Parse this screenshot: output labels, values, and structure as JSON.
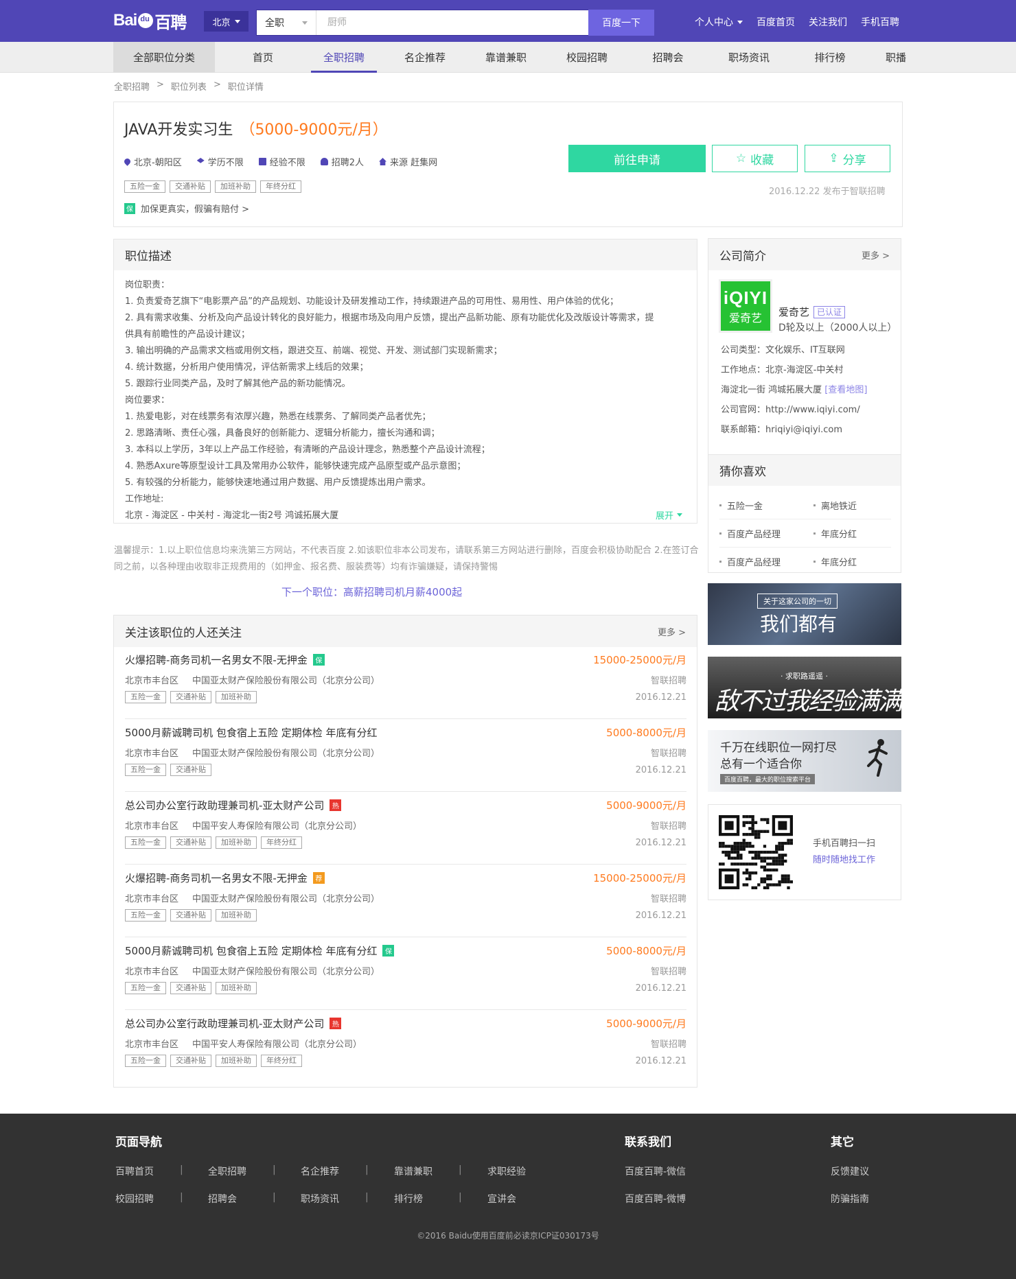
{
  "header": {
    "city": "北京",
    "search": {
      "scope": "全职",
      "placeholder": "厨师",
      "button": "百度一下"
    },
    "links": [
      "个人中心",
      "百度首页",
      "关注我们",
      "手机百聘"
    ]
  },
  "nav": {
    "all": "全部职位分类",
    "items": [
      "首页",
      "全职招聘",
      "名企推荐",
      "靠谱兼职",
      "校园招聘",
      "招聘会",
      "职场资讯",
      "排行榜",
      "职播"
    ],
    "active_index": 1
  },
  "breadcrumb": [
    "全职招聘",
    ">",
    "职位列表",
    ">",
    "职位详情"
  ],
  "job": {
    "title": "JAVA开发实习生",
    "salary": "（5000-9000元/月）",
    "meta": [
      "北京-朝阳区",
      "学历不限",
      "经验不限",
      "招聘2人",
      "来源 赶集网"
    ],
    "meta_icons": [
      "location-icon",
      "graduation-cap-icon",
      "document-icon",
      "person-icon",
      "home-icon"
    ],
    "tags": [
      "五险一金",
      "交通补贴",
      "加班补助",
      "年终分红"
    ],
    "guarantee_badge": "保",
    "guarantee": "加保更真实，假骗有赔付 >",
    "apply": "前往申请",
    "favorite": "收藏",
    "share": "分享",
    "published": "2016.12.22 发布于智联招聘"
  },
  "description": {
    "title": "职位描述",
    "lines": [
      "岗位职责：",
      "1. 负责爱奇艺旗下“电影票产品”的产品规划、功能设计及研发推动工作，持续跟进产品的可用性、易用性、用户体验的优化；",
      "2. 具有需求收集、分析及向产品设计转化的良好能力，根据市场及向用户反馈，提出产品新功能、原有功能优化及改版设计等需求，提",
      "供具有前瞻性的产品设计建议；",
      "3. 输出明确的产品需求文档或用例文档，跟进交互、前端、视觉、开发、测试部门实现新需求；",
      "4. 统计数据，分析用户使用情况，评估新需求上线后的效果；",
      "5. 跟踪行业同类产品，及时了解其他产品的新功能情况。",
      "岗位要求：",
      "1. 热爱电影，对在线票务有浓厚兴趣，熟悉在线票务、了解同类产品者优先；",
      "2. 思路清晰、责任心强，具备良好的创新能力、逻辑分析能力，擅长沟通和调；",
      "3. 本科以上学历，3年以上产品工作经验，有清晰的产品设计理念，熟悉整个产品设计流程；",
      "4. 熟悉Axure等原型设计工具及常用办公软件，能够快速完成产品原型或产品示意图；",
      "5. 有较强的分析能力，能够快速地通过用户数据、用户反馈提炼出用户需求。",
      "工作地址:",
      "北京 - 海淀区 - 中关村 - 海淀北一街2号 鸿诚拓展大厦"
    ],
    "expand": "展开"
  },
  "tips": "温馨提示：1.以上职位信息均来洗第三方网站，不代表百度 2.如该职位非本公司发布，请联系第三方网站进行删除，百度会积极协助配合 2.在签订合同之前，以各种理由收取非正规费用的（如押金、报名费、服装费等）均有诈骗嫌疑，请保持警惕",
  "next_job": "下一个职位：高薪招聘司机月薪4000起",
  "others": {
    "title": "关注该职位的人还关注",
    "more": "更多 >",
    "rows": [
      {
        "title": "火爆招聘-商务司机一名男女不限-无押金",
        "badge": "保",
        "badge_color": "#24c98d",
        "salary": "15000-25000元/月",
        "area": "北京市丰台区",
        "company": "中国亚太财产保险股份有限公司（北京分公司）",
        "source": "智联招聘",
        "date": "2016.12.21",
        "tags": [
          "五险一金",
          "交通补贴",
          "加班补助"
        ]
      },
      {
        "title": "5000月薪诚聘司机 包食宿上五险 定期体检 年底有分红",
        "badge": "",
        "badge_color": "",
        "salary": "5000-8000元/月",
        "area": "北京市丰台区",
        "company": "中国亚太财产保险股份有限公司（北京分公司）",
        "source": "智联招聘",
        "date": "2016.12.21",
        "tags": [
          "五险一金",
          "交通补贴"
        ]
      },
      {
        "title": "总公司办公室行政助理兼司机-亚太财产公司",
        "badge": "热",
        "badge_color": "#e8352e",
        "salary": "5000-9000元/月",
        "area": "北京市丰台区",
        "company": "中国平安人寿保险有限公司（北京分公司）",
        "source": "智联招聘",
        "date": "2016.12.21",
        "tags": [
          "五险一金",
          "交通补贴",
          "加班补助",
          "年终分红"
        ]
      },
      {
        "title": "火爆招聘-商务司机一名男女不限-无押金",
        "badge": "荐",
        "badge_color": "#f39a1e",
        "salary": "15000-25000元/月",
        "area": "北京市丰台区",
        "company": "中国亚太财产保险股份有限公司（北京分公司）",
        "source": "智联招聘",
        "date": "2016.12.21",
        "tags": [
          "五险一金",
          "交通补贴",
          "加班补助"
        ]
      },
      {
        "title": "5000月薪诚聘司机 包食宿上五险 定期体检 年底有分红",
        "badge": "保",
        "badge_color": "#24c98d",
        "salary": "5000-8000元/月",
        "area": "北京市丰台区",
        "company": "中国亚太财产保险股份有限公司（北京分公司）",
        "source": "智联招聘",
        "date": "2016.12.21",
        "tags": [
          "五险一金",
          "交通补贴",
          "加班补助"
        ]
      },
      {
        "title": "总公司办公室行政助理兼司机-亚太财产公司",
        "badge": "热",
        "badge_color": "#e8352e",
        "salary": "5000-9000元/月",
        "area": "北京市丰台区",
        "company": "中国平安人寿保险有限公司（北京分公司）",
        "source": "智联招聘",
        "date": "2016.12.21",
        "tags": [
          "五险一金",
          "交通补贴",
          "加班补助",
          "年终分红"
        ]
      }
    ]
  },
  "company": {
    "title": "公司简介",
    "more": "更多 >",
    "logo_text": "iQIYI",
    "logo_sub": "爱奇艺",
    "name": "爱奇艺",
    "verified": "已认证",
    "scale": "D轮及以上（2000人以上）",
    "type": "公司类型：文化娱乐、IT互联网",
    "location": "工作地点：北京-海淀区-中关村",
    "address": "海淀北一街 鸿城拓展大厦",
    "map_link": "[查看地图]",
    "website": "公司官网：http://www.iqiyi.com/",
    "email": "联系邮箱：hriqiyi@iqiyi.com"
  },
  "guess": {
    "title": "猜你喜欢",
    "items": [
      "五险一金",
      "离地铁近",
      "百度产品经理",
      "年底分红",
      "百度产品经理",
      "年底分红"
    ]
  },
  "banners": {
    "b1_small": "关于这家公司的一切",
    "b1_big": "我们都有",
    "b2_small": "· 求职路遥遥 ·",
    "b2_big": "敌不过我经验满满",
    "b3_line1": "千万在线职位一网打尽",
    "b3_line2": "总有一个适合你",
    "b3_small": "百度百聘，最大的职位搜索平台"
  },
  "qr": {
    "line1": "手机百聘扫一扫",
    "line2": "随时随地找工作"
  },
  "footer": {
    "nav_title": "页面导航",
    "nav_row1": [
      "百聘首页",
      "全职招聘",
      "名企推荐",
      "靠谱兼职",
      "求职经验"
    ],
    "nav_row2": [
      "校园招聘",
      "招聘会",
      "职场资讯",
      "排行榜",
      "宣讲会"
    ],
    "contact_title": "联系我们",
    "contact": [
      "百度百聘-微信",
      "百度百聘-微博"
    ],
    "other_title": "其它",
    "other": [
      "反馈建议",
      "防骗指南"
    ],
    "copyright": "©2016 Baidu使用百度前必读京ICP证030173号"
  },
  "colors": {
    "brand": "#5046b6",
    "accent": "#2fd7a1",
    "salary": "#ff7a1e",
    "link": "#6b63d8"
  }
}
